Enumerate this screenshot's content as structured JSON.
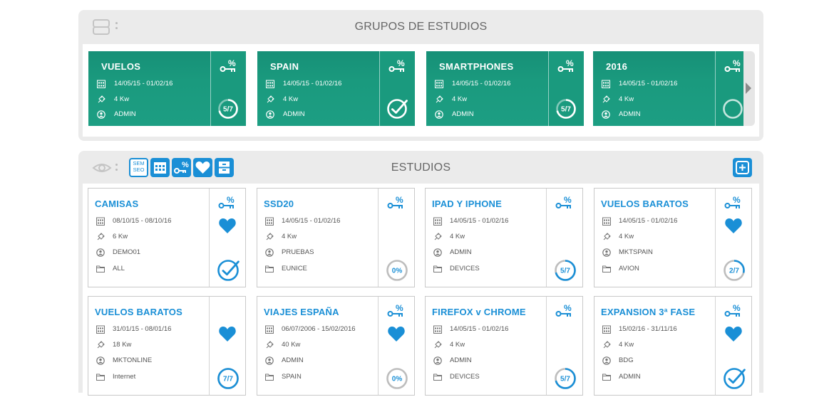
{
  "groups": {
    "title": "GRUPOS DE ESTUDIOS",
    "cards": [
      {
        "name": "VUELOS",
        "dates": "14/05/15 - 01/02/16",
        "power": "4 Kw",
        "user": "ADMIN",
        "status_label": "5/7",
        "status_type": "ring",
        "progress": 0.71
      },
      {
        "name": "SPAIN",
        "dates": "14/05/15 - 01/02/16",
        "power": "4 Kw",
        "user": "ADMIN",
        "status_label": "",
        "status_type": "check",
        "progress": 1
      },
      {
        "name": "SMARTPHONES",
        "dates": "14/05/15 - 01/02/16",
        "power": "4 Kw",
        "user": "ADMIN",
        "status_label": "5/7",
        "status_type": "ring",
        "progress": 0.71
      },
      {
        "name": "2016",
        "dates": "14/05/15 - 01/02/16",
        "power": "4 Kw",
        "user": "ADMIN",
        "status_label": "",
        "status_type": "ring",
        "progress": 0
      }
    ]
  },
  "studies": {
    "title": "ESTUDIOS",
    "toolbar": [
      {
        "name": "sem-seo-button",
        "label_top": "SEM",
        "label_bottom": "SEO"
      },
      {
        "name": "calendar-button"
      },
      {
        "name": "keyword-percent-button"
      },
      {
        "name": "favorites-button"
      },
      {
        "name": "filter-button"
      }
    ],
    "cards": [
      {
        "name": "CAMISAS",
        "dates": "08/10/15 - 08/10/16",
        "power": "6 Kw",
        "user": "DEMO01",
        "folder": "ALL",
        "favorite": true,
        "status_type": "check",
        "status_label": "",
        "progress": 1
      },
      {
        "name": "SSD20",
        "dates": "14/05/15 - 01/02/16",
        "power": "4 Kw",
        "user": "PRUEBAS",
        "folder": "EUNICE",
        "favorite": false,
        "status_type": "ring",
        "status_label": "0%",
        "progress": 0
      },
      {
        "name": "IPAD Y IPHONE",
        "dates": "14/05/15 - 01/02/16",
        "power": "4 Kw",
        "user": "ADMIN",
        "folder": "DEVICES",
        "favorite": false,
        "status_type": "ring",
        "status_label": "5/7",
        "progress": 0.71
      },
      {
        "name": "VUELOS BARATOS",
        "dates": "14/05/15 - 01/02/16",
        "power": "4 Kw",
        "user": "MKTSPAIN",
        "folder": "AVION",
        "favorite": true,
        "status_type": "ring",
        "status_label": "2/7",
        "progress": 0.29
      },
      {
        "name": "VUELOS BARATOS",
        "dates": "31/01/15 - 08/01/16",
        "power": "18 Kw",
        "user": "MKTONLINE",
        "folder": "Internet",
        "favorite": true,
        "status_type": "ring",
        "status_label": "7/7",
        "progress": 1
      },
      {
        "name": "VIAJES ESPAÑA",
        "dates": "06/07/2006 - 15/02/2016",
        "power": "40 Kw",
        "user": "ADMIN",
        "folder": "SPAIN",
        "favorite": true,
        "status_type": "ring",
        "status_label": "0%",
        "progress": 0
      },
      {
        "name": "FIREFOX v CHROME",
        "dates": "14/05/15 - 01/02/16",
        "power": "4 Kw",
        "user": "ADMIN",
        "folder": "DEVICES",
        "favorite": false,
        "status_type": "ring",
        "status_label": "5/7",
        "progress": 0.71
      },
      {
        "name": "EXPANSION 3ª FASE",
        "dates": "15/02/16 - 31/11/16",
        "power": "4 Kw",
        "user": "BDG",
        "folder": "ADMIN",
        "favorite": true,
        "status_type": "check",
        "status_label": "",
        "progress": 1
      }
    ]
  },
  "colors": {
    "group_card": "#1a9a7e",
    "accent_blue": "#1a8fd6",
    "ring_gray": "#bdbdbd"
  }
}
